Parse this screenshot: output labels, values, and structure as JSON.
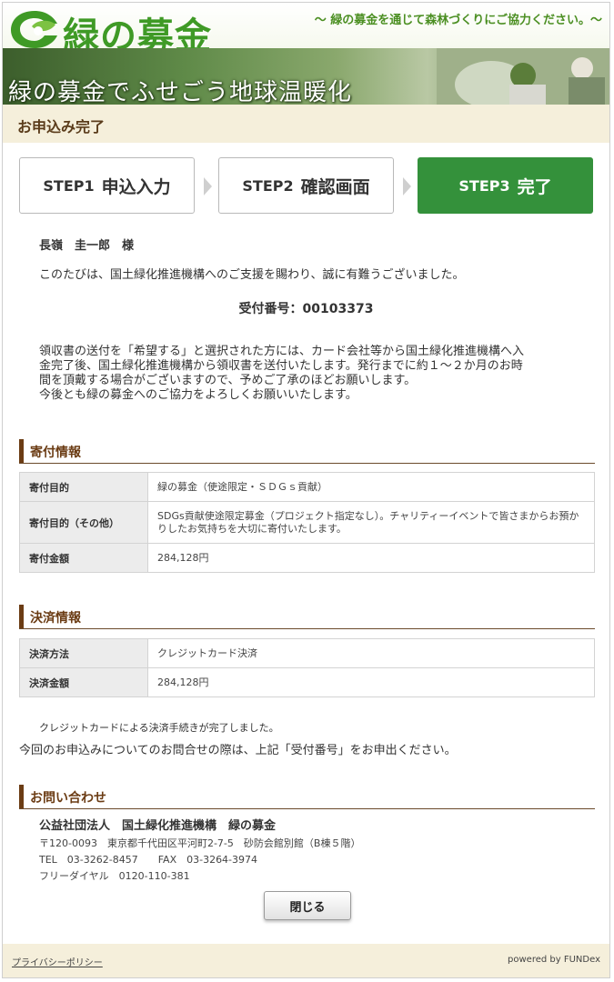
{
  "header": {
    "logo_text": "緑の募金",
    "tagline": "～ 緑の募金を通じて森林づくりにご協力ください。～",
    "banner_text": "緑の募金でふせごう地球温暖化"
  },
  "page_title": "お申込み完了",
  "steps": [
    {
      "num": "STEP1",
      "label": "申込入力"
    },
    {
      "num": "STEP2",
      "label": "確認画面"
    },
    {
      "num": "STEP3",
      "label": "完了"
    }
  ],
  "message": {
    "name": "長嶺　圭一郎　様",
    "thanks": "このたびは、国土緑化推進機構へのご支援を賜わり、誠に有難うございました。",
    "receipt_label": "受付番号：",
    "receipt_number": "00103373",
    "notice": [
      "領収書の送付を「希望する」と選択された方には、カード会社等から国土緑化推進機構へ入",
      "金完了後、国土緑化推進機構から領収書を送付いたします。発行までに約１～２か月のお時",
      "間を頂戴する場合がございますので、予めご了承のほどお願いします。",
      "今後とも緑の募金へのご協力をよろしくお願いいたします。"
    ]
  },
  "donation": {
    "title": "寄付情報",
    "rows": [
      {
        "label": "寄付目的",
        "value": "緑の募金（使途限定・ＳＤＧｓ貢献）"
      },
      {
        "label": "寄付目的（その他）",
        "value": "SDGs貢献使途限定募金（プロジェクト指定なし）。チャリティーイベントで皆さまからお預かりしたお気持ちを大切に寄付いたします。"
      },
      {
        "label": "寄付金額",
        "value": "284,128円"
      }
    ]
  },
  "payment": {
    "title": "決済情報",
    "rows": [
      {
        "label": "決済方法",
        "value": "クレジットカード決済"
      },
      {
        "label": "決済金額",
        "value": "284,128円"
      }
    ],
    "completed_note": "クレジットカードによる決済手続きが完了しました。",
    "inquiry_note": "今回のお申込みについてのお問合せの際は、上記「受付番号」をお申出ください。"
  },
  "contact": {
    "title": "お問い合わせ",
    "org": "公益社団法人　国土緑化推進機構　緑の募金",
    "address": "〒120-0093　東京都千代田区平河町2-7-5　砂防会館別館（B棟５階）",
    "tel_fax": "TEL　03-3262-8457　　FAX　03-3264-3974",
    "freedial": "フリーダイヤル　0120-110-381"
  },
  "close_label": "閉じる",
  "footer": {
    "privacy": "プライバシーポリシー",
    "powered": "powered by FUNDex"
  },
  "colors": {
    "brand_green": "#3f9a26",
    "step_active": "#34913b",
    "section_brown": "#6b3c14",
    "beige": "#f5efdb"
  }
}
